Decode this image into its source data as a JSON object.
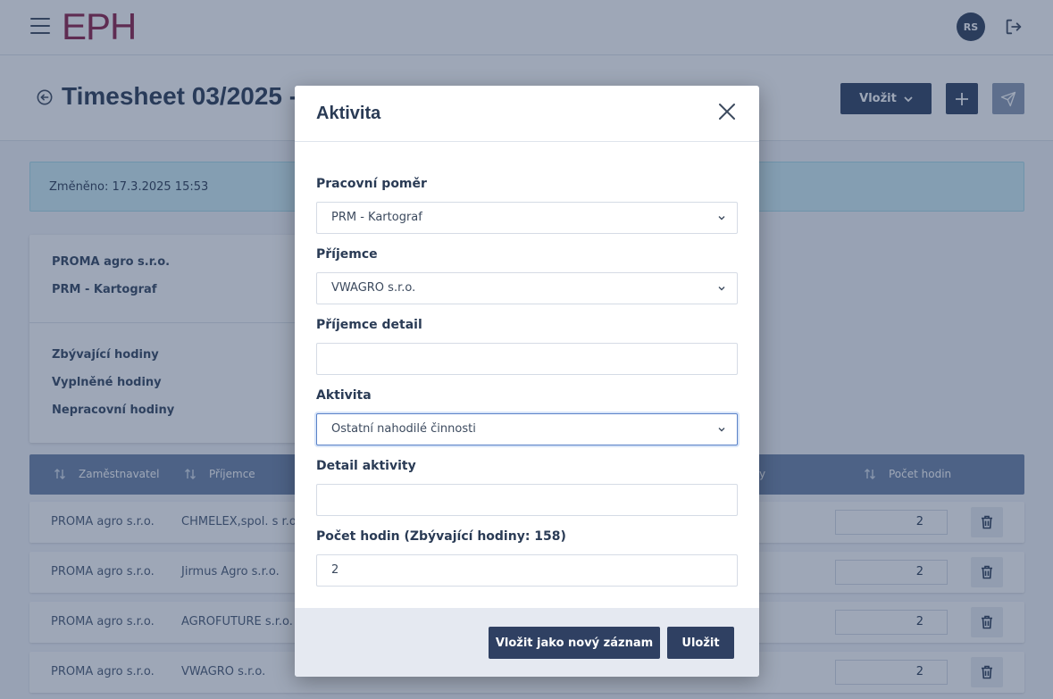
{
  "app": {
    "logo": "EPH",
    "user_initials": "RS"
  },
  "header": {
    "title": "Timesheet 03/2025 -",
    "insert_label": "Vložit"
  },
  "changed": "Změněno: 17.3.2025 15:53",
  "info": {
    "employer": "PROMA agro s.r.o.",
    "position": "PRM - Kartograf",
    "remaining_label": "Zbývající hodiny",
    "filled_label": "Vyplněné hodiny",
    "nonwork_label": "Nepracovní hodiny"
  },
  "table": {
    "headers": {
      "employer": "Zaměstnavatel",
      "recipient": "Příjemce",
      "activity_partial": "y",
      "hours": "Počet hodin"
    },
    "rows": [
      {
        "employer": "PROMA agro s.r.o.",
        "recipient": "CHMELEX,spol. s r.o.",
        "hours": "2"
      },
      {
        "employer": "PROMA agro s.r.o.",
        "recipient": "Jirmus Agro s.r.o.",
        "hours": "2"
      },
      {
        "employer": "PROMA agro s.r.o.",
        "recipient": "AGROFUTURE s.r.o.",
        "hours": "2"
      },
      {
        "employer": "PROMA agro s.r.o.",
        "recipient": "VWAGRO s.r.o.",
        "hours": "2"
      }
    ]
  },
  "modal": {
    "title": "Aktivita",
    "fields": {
      "employment": {
        "label": "Pracovní poměr",
        "value": "PRM - Kartograf"
      },
      "recipient": {
        "label": "Příjemce",
        "value": "VWAGRO s.r.o."
      },
      "recipient_detail": {
        "label": "Příjemce detail",
        "value": ""
      },
      "activity": {
        "label": "Aktivita",
        "value": "Ostatní nahodilé činnosti"
      },
      "activity_detail": {
        "label": "Detail aktivity",
        "value": ""
      },
      "hours": {
        "label": "Počet hodin (Zbývající hodiny: 158)",
        "value": "2"
      }
    },
    "buttons": {
      "insert_new": "Vložit jako nový záznam",
      "save": "Uložit"
    }
  },
  "icons": [
    "menu-icon",
    "logout-icon",
    "back-icon",
    "chevron-down-icon",
    "plus-icon",
    "send-icon",
    "sort-icon",
    "trash-icon",
    "close-icon"
  ],
  "colors": {
    "brand": "#8c2048",
    "primary": "#2f4062",
    "table_header": "#6c82a6",
    "info_bg": "#cfeef6"
  }
}
